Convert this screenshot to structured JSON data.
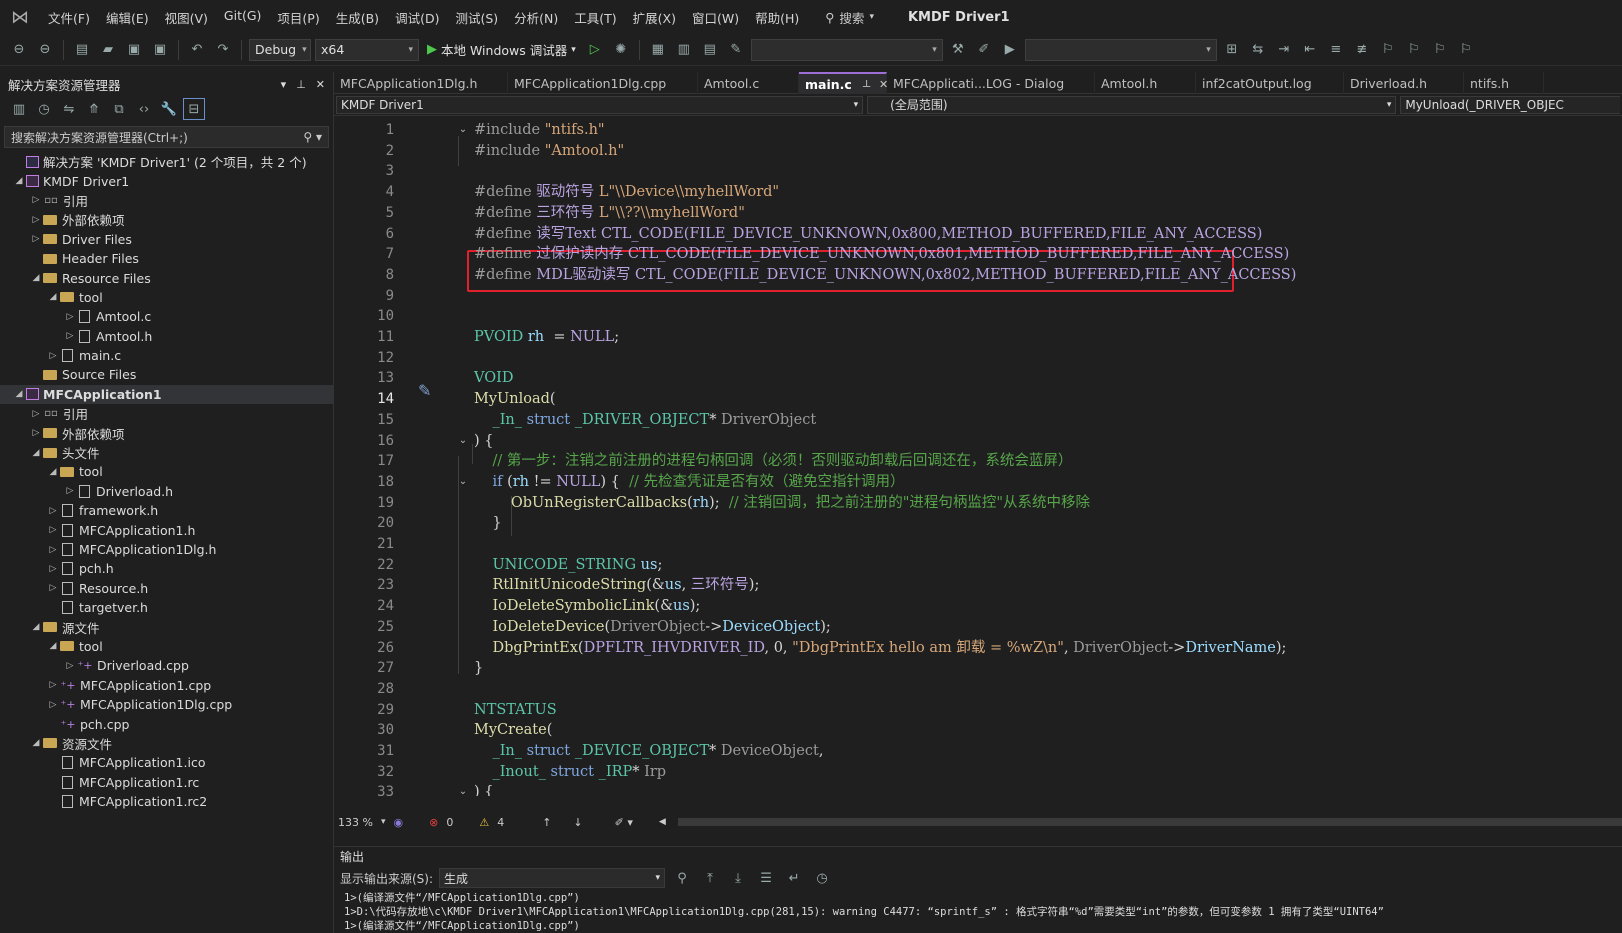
{
  "menubar": {
    "items": [
      "文件(F)",
      "编辑(E)",
      "视图(V)",
      "Git(G)",
      "项目(P)",
      "生成(B)",
      "调试(D)",
      "测试(S)",
      "分析(N)",
      "工具(T)",
      "扩展(X)",
      "窗口(W)",
      "帮助(H)"
    ],
    "search_label": "搜索",
    "app_title": "KMDF Driver1"
  },
  "toolbar": {
    "config": "Debug",
    "platform": "x64",
    "run_label": "本地 Windows 调试器"
  },
  "solution_explorer": {
    "title": "解决方案资源管理器",
    "search_placeholder": "搜索解决方案资源管理器(Ctrl+;)",
    "tree": [
      {
        "label": "解决方案 'KMDF Driver1' (2 个项目，共 2 个)",
        "indent": 0,
        "exp": "",
        "icon": "sln"
      },
      {
        "label": "KMDF Driver1",
        "indent": 0,
        "exp": "◢",
        "icon": "proj"
      },
      {
        "label": "引用",
        "indent": 1,
        "exp": "▷",
        "icon": "ref"
      },
      {
        "label": "外部依赖项",
        "indent": 1,
        "exp": "▷",
        "icon": "folder"
      },
      {
        "label": "Driver Files",
        "indent": 1,
        "exp": "▷",
        "icon": "folder"
      },
      {
        "label": "Header Files",
        "indent": 1,
        "exp": "",
        "icon": "folder"
      },
      {
        "label": "Resource Files",
        "indent": 1,
        "exp": "◢",
        "icon": "folder"
      },
      {
        "label": "tool",
        "indent": 2,
        "exp": "◢",
        "icon": "folder"
      },
      {
        "label": "Amtool.c",
        "indent": 3,
        "exp": "▷",
        "icon": "file"
      },
      {
        "label": "Amtool.h",
        "indent": 3,
        "exp": "▷",
        "icon": "file"
      },
      {
        "label": "main.c",
        "indent": 2,
        "exp": "▷",
        "icon": "file"
      },
      {
        "label": "Source Files",
        "indent": 1,
        "exp": "",
        "icon": "folder"
      },
      {
        "label": "MFCApplication1",
        "indent": 0,
        "exp": "◢",
        "icon": "proj",
        "selected": true
      },
      {
        "label": "引用",
        "indent": 1,
        "exp": "▷",
        "icon": "ref"
      },
      {
        "label": "外部依赖项",
        "indent": 1,
        "exp": "▷",
        "icon": "folder"
      },
      {
        "label": "头文件",
        "indent": 1,
        "exp": "◢",
        "icon": "folder"
      },
      {
        "label": "tool",
        "indent": 2,
        "exp": "◢",
        "icon": "folder"
      },
      {
        "label": "Driverload.h",
        "indent": 3,
        "exp": "▷",
        "icon": "file"
      },
      {
        "label": "framework.h",
        "indent": 2,
        "exp": "▷",
        "icon": "file"
      },
      {
        "label": "MFCApplication1.h",
        "indent": 2,
        "exp": "▷",
        "icon": "file"
      },
      {
        "label": "MFCApplication1Dlg.h",
        "indent": 2,
        "exp": "▷",
        "icon": "file"
      },
      {
        "label": "pch.h",
        "indent": 2,
        "exp": "▷",
        "icon": "file"
      },
      {
        "label": "Resource.h",
        "indent": 2,
        "exp": "▷",
        "icon": "file"
      },
      {
        "label": "targetver.h",
        "indent": 2,
        "exp": "",
        "icon": "file"
      },
      {
        "label": "源文件",
        "indent": 1,
        "exp": "◢",
        "icon": "folder"
      },
      {
        "label": "tool",
        "indent": 2,
        "exp": "◢",
        "icon": "folder"
      },
      {
        "label": "Driverload.cpp",
        "indent": 3,
        "exp": "▷",
        "icon": "cpp"
      },
      {
        "label": "MFCApplication1.cpp",
        "indent": 2,
        "exp": "▷",
        "icon": "cpp"
      },
      {
        "label": "MFCApplication1Dlg.cpp",
        "indent": 2,
        "exp": "▷",
        "icon": "cpp"
      },
      {
        "label": "pch.cpp",
        "indent": 2,
        "exp": "",
        "icon": "cpp"
      },
      {
        "label": "资源文件",
        "indent": 1,
        "exp": "◢",
        "icon": "folder"
      },
      {
        "label": "MFCApplication1.ico",
        "indent": 2,
        "exp": "",
        "icon": "file"
      },
      {
        "label": "MFCApplication1.rc",
        "indent": 2,
        "exp": "",
        "icon": "file"
      },
      {
        "label": "MFCApplication1.rc2",
        "indent": 2,
        "exp": "",
        "icon": "file"
      }
    ]
  },
  "editor": {
    "tabs": [
      "MFCApplication1Dlg.h",
      "MFCApplication1Dlg.cpp",
      "Amtool.c",
      "main.c",
      "MFCApplicati...LOG - Dialog",
      "Amtool.h",
      "inf2catOutput.log",
      "Driverload.h",
      "ntifs.h"
    ],
    "active_tab": "main.c",
    "nav_project": "KMDF Driver1",
    "nav_scope": "(全局范围)",
    "nav_member": "MyUnload(_DRIVER_OBJEC",
    "current_line": 14,
    "lines": [
      [
        [
          "pp",
          "#include "
        ],
        [
          "str",
          "\"ntifs.h\""
        ]
      ],
      [
        [
          "pp",
          "#include "
        ],
        [
          "str",
          "\"Amtool.h\""
        ]
      ],
      [],
      [
        [
          "pp",
          "#define "
        ],
        [
          "mac",
          "驱动符号 "
        ],
        [
          "str",
          "L\"\\\\Device\\\\myhellWord\""
        ]
      ],
      [
        [
          "pp",
          "#define "
        ],
        [
          "mac",
          "三环符号 "
        ],
        [
          "str",
          "L\"\\\\??\\\\myhellWord\""
        ]
      ],
      [
        [
          "pp",
          "#define "
        ],
        [
          "mac",
          "读写Text "
        ],
        [
          "mac",
          "CTL_CODE(FILE_DEVICE_UNKNOWN,0x800,METHOD_BUFFERED,FILE_ANY_ACCESS)"
        ]
      ],
      [
        [
          "pp",
          "#define "
        ],
        [
          "mac",
          "过保护读内存 CTL_CODE(FILE_DEVICE_UNKNOWN,0x801,METHOD_BUFFERED,FILE_ANY_ACCESS)"
        ]
      ],
      [
        [
          "pp",
          "#define "
        ],
        [
          "mac",
          "MDL驱动读写 "
        ],
        [
          "mac",
          "CTL_CODE(FILE_DEVICE_UNKNOWN,0x802,METHOD_BUFFERED,FILE_ANY_ACCESS)"
        ]
      ],
      [],
      [],
      [
        [
          "ty",
          "PVOID "
        ],
        [
          "id",
          "rh"
        ],
        [
          "",
          "  = "
        ],
        [
          "mac",
          "NULL"
        ],
        [
          "",
          ";"
        ]
      ],
      [],
      [
        [
          "ty",
          "VOID"
        ]
      ],
      [
        [
          "fn",
          "MyUnload"
        ],
        [
          "",
          "("
        ]
      ],
      [
        [
          "",
          "    "
        ],
        [
          "ty",
          "_In_ "
        ],
        [
          "kw",
          "struct "
        ],
        [
          "ty",
          "_DRIVER_OBJECT"
        ],
        [
          "",
          "* "
        ],
        [
          "prm",
          "DriverObject"
        ]
      ],
      [
        [
          "",
          ") {"
        ]
      ],
      [
        [
          "",
          "    "
        ],
        [
          "cm",
          "// 第一步：注销之前注册的进程句柄回调（必须！否则驱动卸载后回调还在，系统会蓝屏）"
        ]
      ],
      [
        [
          "",
          "    "
        ],
        [
          "kw",
          "if "
        ],
        [
          "",
          "("
        ],
        [
          "id",
          "rh"
        ],
        [
          "",
          " != "
        ],
        [
          "mac",
          "NULL"
        ],
        [
          "",
          ") {  "
        ],
        [
          "cm",
          "// 先检查凭证是否有效（避免空指针调用）"
        ]
      ],
      [
        [
          "",
          "        "
        ],
        [
          "fn",
          "ObUnRegisterCallbacks"
        ],
        [
          "",
          "("
        ],
        [
          "id",
          "rh"
        ],
        [
          "",
          ");  "
        ],
        [
          "cm",
          "// 注销回调，把之前注册的\"进程句柄监控\"从系统中移除"
        ]
      ],
      [
        [
          "",
          "    }"
        ]
      ],
      [],
      [
        [
          "",
          "    "
        ],
        [
          "ty",
          "UNICODE_STRING "
        ],
        [
          "id",
          "us"
        ],
        [
          "",
          ";"
        ]
      ],
      [
        [
          "",
          "    "
        ],
        [
          "fn",
          "RtlInitUnicodeString"
        ],
        [
          "",
          "(&"
        ],
        [
          "id",
          "us"
        ],
        [
          "",
          ", "
        ],
        [
          "mac",
          "三环符号"
        ],
        [
          "",
          ");"
        ]
      ],
      [
        [
          "",
          "    "
        ],
        [
          "fn",
          "IoDeleteSymbolicLink"
        ],
        [
          "",
          "(&"
        ],
        [
          "id",
          "us"
        ],
        [
          "",
          ");"
        ]
      ],
      [
        [
          "",
          "    "
        ],
        [
          "fn",
          "IoDeleteDevice"
        ],
        [
          "",
          "("
        ],
        [
          "prm",
          "DriverObject"
        ],
        [
          "",
          "->"
        ],
        [
          "id",
          "DeviceObject"
        ],
        [
          "",
          ");"
        ]
      ],
      [
        [
          "",
          "    "
        ],
        [
          "fn",
          "DbgPrintEx"
        ],
        [
          "",
          "("
        ],
        [
          "mac",
          "DPFLTR_IHVDRIVER_ID"
        ],
        [
          "",
          ", "
        ],
        [
          "",
          "0"
        ],
        [
          "",
          ", "
        ],
        [
          "str",
          "\"DbgPrintEx hello am 卸载 = %wZ\\n\""
        ],
        [
          "",
          ", "
        ],
        [
          "prm",
          "DriverObject"
        ],
        [
          "",
          "->"
        ],
        [
          "id",
          "DriverName"
        ],
        [
          "",
          ");"
        ]
      ],
      [
        [
          "",
          "}"
        ]
      ],
      [],
      [
        [
          "ty",
          "NTSTATUS"
        ]
      ],
      [
        [
          "fn",
          "MyCreate"
        ],
        [
          "",
          "("
        ]
      ],
      [
        [
          "",
          "    "
        ],
        [
          "ty",
          "_In_ "
        ],
        [
          "kw",
          "struct "
        ],
        [
          "ty",
          "_DEVICE_OBJECT"
        ],
        [
          "",
          "* "
        ],
        [
          "prm",
          "DeviceObject"
        ],
        [
          "",
          ","
        ]
      ],
      [
        [
          "",
          "    "
        ],
        [
          "ty",
          "_Inout_ "
        ],
        [
          "kw",
          "struct "
        ],
        [
          "ty",
          "_IRP"
        ],
        [
          "",
          "* "
        ],
        [
          "prm",
          "Irp"
        ]
      ],
      [
        [
          "",
          ") {"
        ]
      ]
    ]
  },
  "status": {
    "zoom": "133 %",
    "errors": "0",
    "warnings": "4"
  },
  "output": {
    "title": "输出",
    "source_label": "显示输出来源(S):",
    "source_value": "生成",
    "lines": [
      "1>(编译源文件“/MFCApplication1Dlg.cpp”)",
      "1>D:\\代码存放地\\c\\KMDF Driver1\\MFCApplication1\\MFCApplication1Dlg.cpp(281,15): warning C4477: “sprintf_s” : 格式字符串“%d”需要类型“int”的参数，但可变参数 1 拥有了类型“UINT64”",
      "1>(编译源文件“/MFCApplication1Dlg.cpp”)"
    ]
  }
}
